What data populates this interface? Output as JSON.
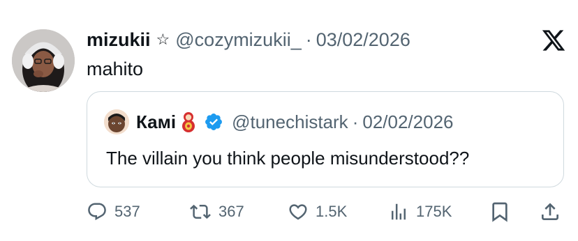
{
  "tweet": {
    "author_name": "mizukii",
    "author_star": "☆",
    "author_handle": "@cozymizukii_",
    "separator": "·",
    "date": "03/02/2026",
    "text": "mahito"
  },
  "quoted": {
    "author_name": "Камі",
    "author_handle": "@tunechistark",
    "separator": "·",
    "date": "02/02/2026",
    "text": "The villain you think people misunderstood??"
  },
  "actions": {
    "replies": "537",
    "reposts": "367",
    "likes": "1.5K",
    "views": "175K"
  },
  "colors": {
    "text_primary": "#0f1419",
    "text_secondary": "#536471",
    "verified_blue": "#1d9bf0",
    "border": "#cfd9de"
  }
}
